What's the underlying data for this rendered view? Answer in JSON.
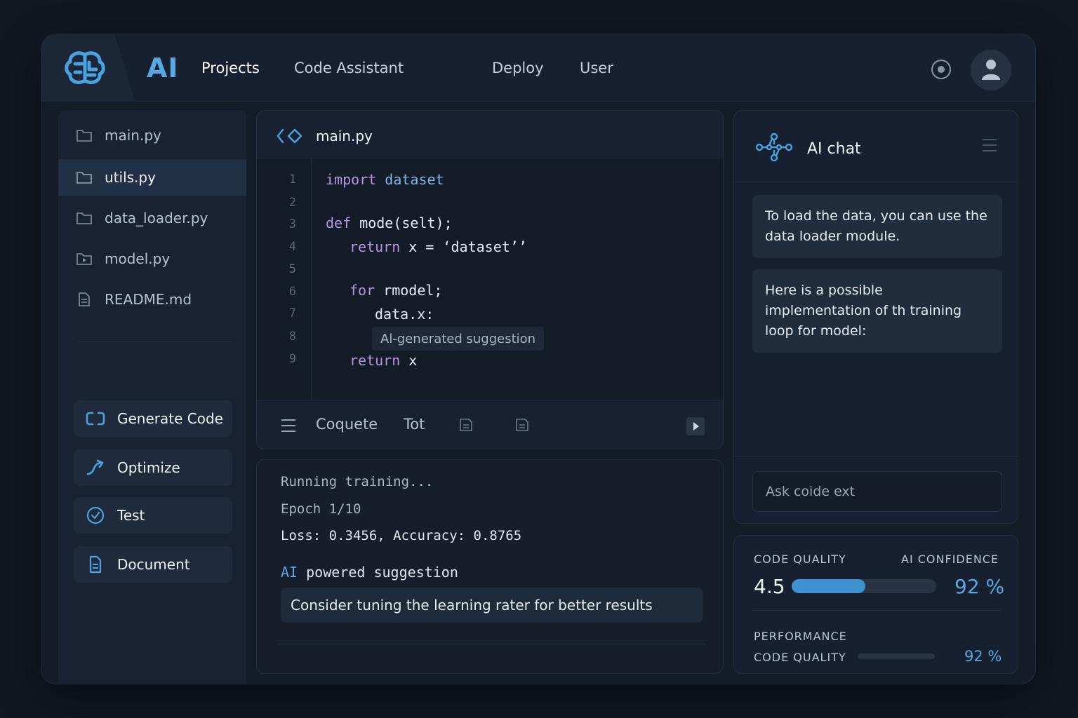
{
  "header": {
    "brand": "AI",
    "nav": [
      "Projects",
      "Code Assistant",
      "Deploy",
      "User"
    ]
  },
  "sidebar": {
    "files": [
      {
        "name": "main.py",
        "icon": "folder-icon"
      },
      {
        "name": "utils.py",
        "icon": "folder-icon",
        "selected": true
      },
      {
        "name": "data_loader.py",
        "icon": "folder-icon"
      },
      {
        "name": "model.py",
        "icon": "folder-play-icon"
      },
      {
        "name": "README.md",
        "icon": "document-icon"
      }
    ],
    "actions": [
      {
        "label": "Generate Code",
        "icon": "code-brackets-icon"
      },
      {
        "label": "Optimize",
        "icon": "trend-arrow-icon"
      },
      {
        "label": "Test",
        "icon": "check-circle-icon"
      },
      {
        "label": "Document",
        "icon": "document-icon"
      }
    ]
  },
  "editor": {
    "filename": "main.py",
    "line_numbers": [
      "1",
      "2",
      "3",
      "4",
      "5",
      "6",
      "7",
      "8",
      "9"
    ],
    "code": {
      "l1_kw": "import",
      "l1_rest": " dataset",
      "l3_kw": "def",
      "l3_rest": " mode(selt);",
      "l4_kw": "return",
      "l4_rest": " x = ‘dataset’’",
      "l6_kw": "for",
      "l6_rest": " rmodel;",
      "l7": "data.x:",
      "l9_kw": "return",
      "l9_rest": " x"
    },
    "suggestion": "Al-generated suggestion",
    "toolbar": {
      "item1": "Coquete",
      "item2": "Tot"
    }
  },
  "console": {
    "lines": [
      "Running training...",
      "Epoch 1/10",
      "Loss: 0.3456, Accuracy: 0.8765"
    ],
    "ai_word": "AI",
    "ai_rest": "powered suggestion",
    "tip": "Consider tuning the learning rater for better results"
  },
  "chat": {
    "title": "AI chat",
    "messages": [
      "To load the data, you can use the data loader module.",
      "Here is a possible implementation of th training loop for model:"
    ],
    "input_placeholder": "Ask coide ext"
  },
  "metrics": {
    "code_quality_label": "CODE QUALITY",
    "ai_confidence_label": "AI CONFIDENCE",
    "code_quality_value": "4.5",
    "code_quality_bar_fraction": 0.51,
    "ai_confidence_value": "92 %",
    "performance_label": "PERFORMANCE",
    "code_quality_label_2": "CODE QUALITY",
    "code_quality_2_value": "92 %",
    "code_quality_2_bar_fraction": 0.0
  },
  "colors": {
    "accent": "#58a9e3",
    "background": "#111822",
    "panel": "#162030",
    "keyword": "#b793e6"
  }
}
